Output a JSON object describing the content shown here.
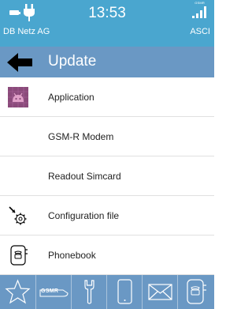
{
  "status_bar": {
    "time": "13:53",
    "operator": "DB Netz AG",
    "mode": "ASCI",
    "signal_tag": "GSMR",
    "icons": [
      "battery-icon",
      "charging-plug-icon",
      "signal-strength-icon"
    ]
  },
  "title_bar": {
    "title": "Update",
    "back_icon": "back-arrow-icon"
  },
  "menu": {
    "items": [
      {
        "label": "Application",
        "icon": "android-icon"
      },
      {
        "label": "GSM-R Modem",
        "icon": ""
      },
      {
        "label": "Readout Simcard",
        "icon": ""
      },
      {
        "label": "Configuration file",
        "icon": "config-gear-icon"
      },
      {
        "label": "Phonebook",
        "icon": "phonebook-icon"
      }
    ]
  },
  "bottom_bar": {
    "gsmr_label": "GSMR",
    "icons": [
      "star-icon",
      "gsmr-logo-icon",
      "wrench-icon",
      "phone-icon",
      "mail-icon",
      "phonebook-icon"
    ]
  },
  "colors": {
    "status_bar_bg": "#4aa6cf",
    "title_bar_bg": "#6a98c4",
    "android_icon_bg": "#8a4a7a",
    "android_icon_fg": "#e0a0c8"
  }
}
